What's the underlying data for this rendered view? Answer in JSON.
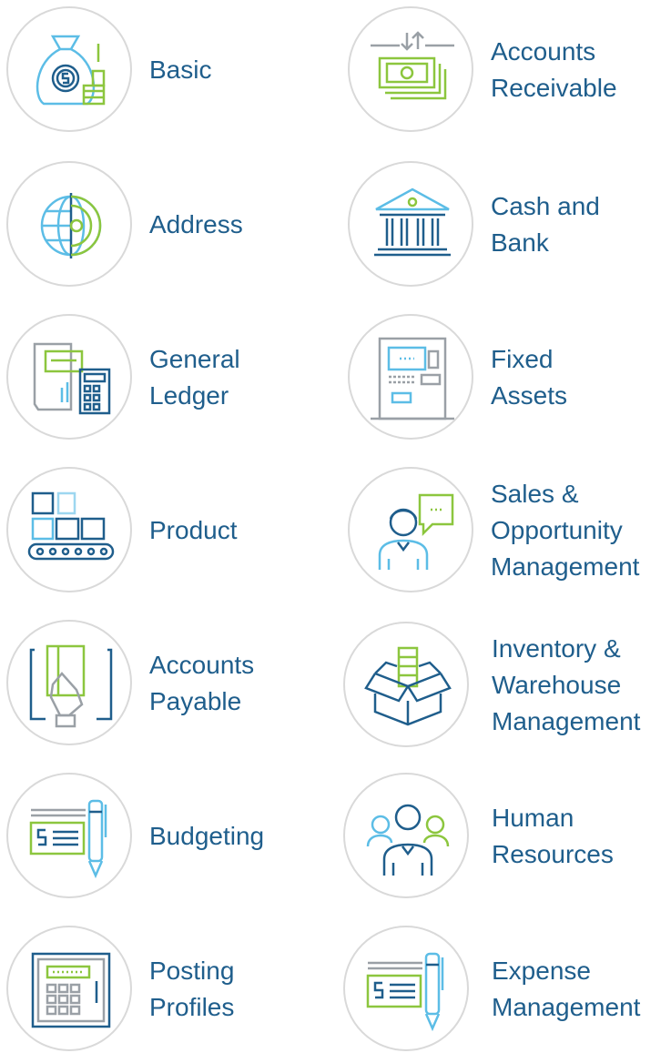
{
  "colors": {
    "blue": "#1f5e8c",
    "light_blue": "#5cbde6",
    "green": "#8cc63e",
    "gray": "#9aa0a6",
    "circle_border": "#d9d9d9"
  },
  "modules": [
    {
      "icon": "money-bag-icon",
      "lines": [
        "Basic"
      ]
    },
    {
      "icon": "cash-transfer-icon",
      "lines": [
        "Accounts",
        "Receivable"
      ]
    },
    {
      "icon": "globe-gear-icon",
      "lines": [
        "Address"
      ]
    },
    {
      "icon": "bank-building-icon",
      "lines": [
        "Cash and",
        "Bank"
      ]
    },
    {
      "icon": "ledger-calculator-icon",
      "lines": [
        "General",
        "Ledger"
      ]
    },
    {
      "icon": "atm-machine-icon",
      "lines": [
        "Fixed",
        "Assets"
      ]
    },
    {
      "icon": "conveyor-boxes-icon",
      "lines": [
        "Product"
      ]
    },
    {
      "icon": "salesperson-chat-icon",
      "lines": [
        "Sales &",
        "Opportunity",
        "Management"
      ]
    },
    {
      "icon": "hand-card-icon",
      "lines": [
        "Accounts",
        "Payable"
      ]
    },
    {
      "icon": "open-box-icon",
      "lines": [
        "Inventory &",
        "Warehouse",
        "Management"
      ]
    },
    {
      "icon": "budget-pen-icon",
      "lines": [
        "Budgeting"
      ]
    },
    {
      "icon": "team-people-icon",
      "lines": [
        "Human",
        "Resources"
      ]
    },
    {
      "icon": "safe-keypad-icon",
      "lines": [
        "Posting",
        "Profiles"
      ]
    },
    {
      "icon": "expense-pen-icon",
      "lines": [
        "Expense",
        "Management"
      ]
    }
  ]
}
